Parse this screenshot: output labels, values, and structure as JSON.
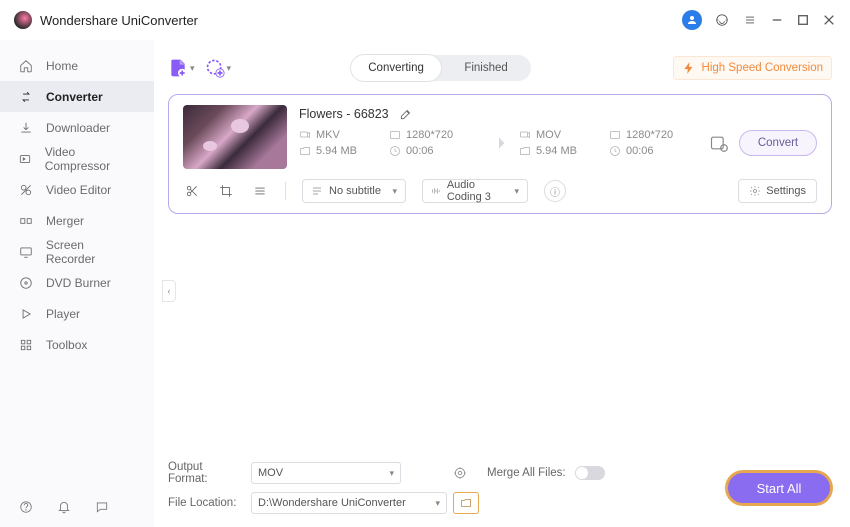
{
  "app": {
    "title": "Wondershare UniConverter"
  },
  "sidebar": {
    "items": [
      {
        "label": "Home"
      },
      {
        "label": "Converter"
      },
      {
        "label": "Downloader"
      },
      {
        "label": "Video Compressor"
      },
      {
        "label": "Video Editor"
      },
      {
        "label": "Merger"
      },
      {
        "label": "Screen Recorder"
      },
      {
        "label": "DVD Burner"
      },
      {
        "label": "Player"
      },
      {
        "label": "Toolbox"
      }
    ]
  },
  "tabs": {
    "converting": "Converting",
    "finished": "Finished"
  },
  "hispeed": "High Speed Conversion",
  "file": {
    "name": "Flowers - 66823",
    "src": {
      "format": "MKV",
      "resolution": "1280*720",
      "size": "5.94 MB",
      "duration": "00:06"
    },
    "dst": {
      "format": "MOV",
      "resolution": "1280*720",
      "size": "5.94 MB",
      "duration": "00:06"
    },
    "convert": "Convert",
    "subtitle": "No subtitle",
    "audio": "Audio Coding 3",
    "settings": "Settings"
  },
  "footer": {
    "outputFormatLabel": "Output Format:",
    "outputFormat": "MOV",
    "mergeLabel": "Merge All Files:",
    "fileLocationLabel": "File Location:",
    "fileLocation": "D:\\Wondershare UniConverter",
    "startAll": "Start All"
  }
}
